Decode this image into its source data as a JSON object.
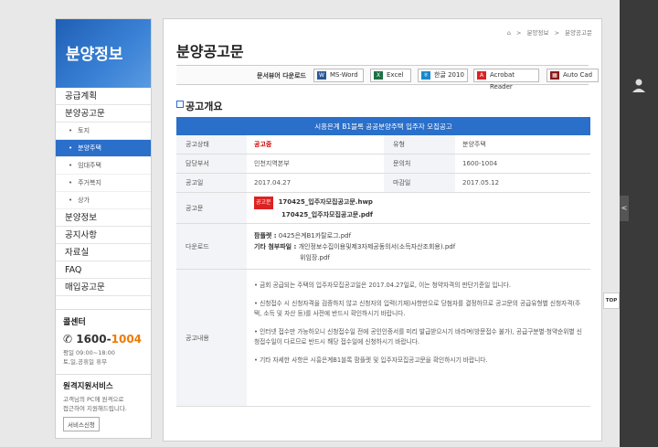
{
  "sidebar": {
    "title": "분양정보",
    "menu": [
      {
        "label": "공급계획",
        "level": 1
      },
      {
        "label": "분양공고문",
        "level": 1
      },
      {
        "label": "토지",
        "level": 2
      },
      {
        "label": "분양주택",
        "level": 2,
        "active": true
      },
      {
        "label": "임대주택",
        "level": 2
      },
      {
        "label": "주거복지",
        "level": 2
      },
      {
        "label": "상가",
        "level": 2
      },
      {
        "label": "분양정보",
        "level": 1
      },
      {
        "label": "공지사항",
        "level": 1
      },
      {
        "label": "자료실",
        "level": 1
      },
      {
        "label": "FAQ",
        "level": 1
      },
      {
        "label": "매입공고문",
        "level": 1
      }
    ],
    "call_center": {
      "title": "콜센터",
      "phone_a": "1600-",
      "phone_b": "1004",
      "hours1": "평일 09:00~18:00",
      "hours2": "토,일,공휴일 휴무"
    },
    "remote": {
      "title": "원격지원서비스",
      "desc1": "고객님의 PC에 원격으로",
      "desc2": "접근하여 지원해드립니다.",
      "button": "서비스신청"
    }
  },
  "breadcrumb": {
    "home": "⌂",
    "level1": "분양정보",
    "sep": ">",
    "level2": "분양공고문"
  },
  "page_title": "분양공고문",
  "download_bar": {
    "label": "문서뷰어 다운로드",
    "formats": [
      {
        "label": "MS-Word",
        "icon": "W",
        "color": "#2b5797"
      },
      {
        "label": "Excel",
        "icon": "X",
        "color": "#1e7145"
      },
      {
        "label": "한글 2010",
        "icon": "ㅎ",
        "color": "#1a88c9"
      },
      {
        "label": "Acrobat Reader",
        "icon": "A",
        "color": "#d22"
      },
      {
        "label": "Auto Cad",
        "icon": "▦",
        "color": "#8a1a1a"
      }
    ]
  },
  "section_title": "공고개요",
  "notice": {
    "title": "시흥은계 B1블록 공공분양주택 입주자 모집공고",
    "status_label": "공고상태",
    "status_value": "공고중",
    "type_label": "유형",
    "type_value": "분양주택",
    "org_label": "담당부서",
    "org_value": "인천지역본부",
    "contact_label": "문의처",
    "contact_value": "1600-1004",
    "date_label": "공고일",
    "date_value": "2017.04.27",
    "deadline_label": "마감일",
    "deadline_value": "2017.05.12",
    "doc_label": "공고문",
    "doc_badge": "공고문",
    "doc_file1": "170425_입주자모집공고문.hwp",
    "doc_file2": "170425_입주자모집공고문.pdf",
    "download_label": "다운로드",
    "dl_brochure_label": "팜플렛 :",
    "dl_brochure_file": "0425은계B1카탈로그.pdf",
    "dl_other_label": "기타 첨부파일 :",
    "dl_other_file1": "개인정보수집이용및제3자제공동의서(소득자산조회용).pdf",
    "dl_other_file2": "위임장.pdf",
    "content_label": "공고내용",
    "content": [
      "• 금회 공급되는 주택의 입주자모집공고일은 2017.04.27일로, 이는 청약자격의 판단기준일 입니다.",
      "• 신청접수 시 신청자격을 검증하지 않고 신청자의 입력(기재)사항만으로 당첨자를 결정하므로 공고문의 공급유형별 신청자격(주택, 소득 및 자산 등)를 사전에 반드시 확인하시기 바랍니다.",
      "• 인터넷 접수만 가능하오니 신청접수일 전에 공인인증서를 미리 발급받으시기 바라며(방문접수 불가), 공급구분별·청약순위별 신청접수일이 다르므로 반드시 해당 접수일에 신청하시기 바랍니다.",
      "• 기타 자세한 사항은 시흥은계B1블록 팜플렛 및 입주자모집공고문을 확인하시기 바랍니다."
    ]
  },
  "top_button": "TOP",
  "right_tab": "<"
}
